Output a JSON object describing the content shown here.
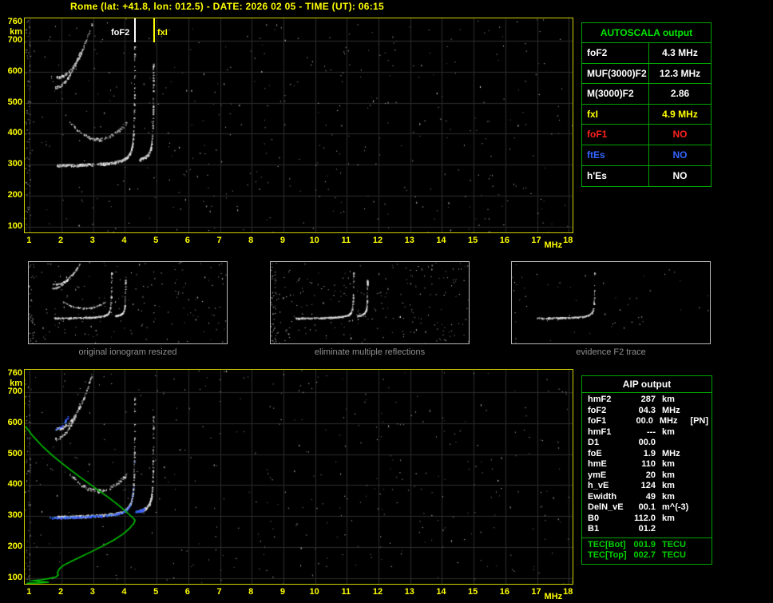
{
  "header": {
    "title": "Rome (lat: +41.8, lon: 012.5) - DATE: 2026 02 05 - TIME (UT): 06:15"
  },
  "autoscala_table": {
    "title": "AUTOSCALA output",
    "rows": [
      {
        "label": "foF2",
        "value": "4.3 MHz",
        "color": "#ffffff"
      },
      {
        "label": "MUF(3000)F2",
        "value": "12.3 MHz",
        "color": "#ffffff"
      },
      {
        "label": "M(3000)F2",
        "value": "2.86",
        "color": "#ffffff"
      },
      {
        "label": "fxI",
        "value": "4.9 MHz",
        "color": "#ffff00"
      },
      {
        "label": "foF1",
        "value": "NO",
        "color": "#ff2020"
      },
      {
        "label": "ftEs",
        "value": "NO",
        "color": "#3366ff"
      },
      {
        "label": "h'Es",
        "value": "NO",
        "color": "#ffffff"
      }
    ]
  },
  "thumbnails": [
    {
      "caption": "original ionogram resized"
    },
    {
      "caption": "eliminate multiple reflections"
    },
    {
      "caption": "evidence F2 trace"
    }
  ],
  "aip_table": {
    "title": "AIP output",
    "rows": [
      {
        "name": "hmF2",
        "value": "287",
        "unit": "km",
        "note": ""
      },
      {
        "name": "foF2",
        "value": "04.3",
        "unit": "MHz",
        "note": ""
      },
      {
        "name": "foF1",
        "value": "00.0",
        "unit": "MHz",
        "note": "[PN]"
      },
      {
        "name": "hmF1",
        "value": "---",
        "unit": "km",
        "note": ""
      },
      {
        "name": "D1",
        "value": "00.0",
        "unit": "",
        "note": ""
      },
      {
        "name": "foE",
        "value": "1.9",
        "unit": "MHz",
        "note": ""
      },
      {
        "name": "hmE",
        "value": "110",
        "unit": "km",
        "note": ""
      },
      {
        "name": "ymE",
        "value": "20",
        "unit": "km",
        "note": ""
      },
      {
        "name": "h_vE",
        "value": "124",
        "unit": "km",
        "note": ""
      },
      {
        "name": "Ewidth",
        "value": "49",
        "unit": "km",
        "note": ""
      },
      {
        "name": "DelN_vE",
        "value": "00.1",
        "unit": "m^(-3)",
        "note": ""
      },
      {
        "name": "B0",
        "value": "112.0",
        "unit": "km",
        "note": ""
      },
      {
        "name": "B1",
        "value": "01.2",
        "unit": "",
        "note": ""
      }
    ],
    "tec_rows": [
      {
        "name": "TEC[Bot]",
        "value": "001.9",
        "unit": "TECU"
      },
      {
        "name": "TEC[Top]",
        "value": "002.7",
        "unit": "TECU"
      }
    ]
  },
  "chart_data": {
    "type": "scatter",
    "description": "Vertical-incidence ionograms (virtual height km vs frequency MHz). Top: recorded ionogram with autoscaled foF2/fxI markers. Bottom: same ionogram with restored trace (blue) and electron density profile (green).",
    "x_axis": {
      "label": "MHz",
      "ticks": [
        1,
        2,
        3,
        4,
        5,
        6,
        7,
        8,
        9,
        10,
        11,
        12,
        13,
        14,
        15,
        16,
        17,
        18
      ],
      "range": [
        0.84,
        18.12
      ]
    },
    "y_axis": {
      "label": "km",
      "ticks": [
        760,
        700,
        600,
        500,
        400,
        300,
        200,
        100
      ],
      "gridlines": [
        100,
        200,
        300,
        400,
        500,
        600,
        700
      ],
      "range": [
        82,
        772
      ]
    },
    "grid_color": "#2d2d2d",
    "border_color": "#d0d000",
    "profile_color": "#00c000",
    "annotations": {
      "foF2_label": "foF2",
      "foF2_mhz": 4.3,
      "fxI_label": "fxI",
      "fxI_mhz": 4.9
    },
    "scaled_values": {
      "foF2_mhz": 4.3,
      "fxI_mhz": 4.9,
      "hmF2_km": 287,
      "MUF3000F2_mhz": 12.3,
      "M3000F2": 2.86
    },
    "traces": {
      "f2_ordinary": {
        "type": "asym",
        "f0": 1.85,
        "f1": 4.295,
        "h0": 292,
        "a": 12,
        "fc": 4.305,
        "p": 0.72,
        "n": 300,
        "jitter": 4,
        "hmax": 740
      },
      "f2_cusp": {
        "type": "asym",
        "f0": 3.3,
        "f1": 4.297,
        "h0": 292,
        "a": 12,
        "fc": 4.305,
        "p": 0.72,
        "n": 130,
        "jitter": 3,
        "bias": 3,
        "hmax": 755
      },
      "fx_cusp": {
        "type": "asym",
        "f0": 4.45,
        "f1": 4.888,
        "h0": 300,
        "a": 10,
        "fc": 4.895,
        "p": 0.7,
        "n": 150,
        "jitter": 4,
        "bias": 2.2,
        "hmax": 755
      },
      "multiple_arc": {
        "type": "parab",
        "f0": 2.25,
        "f1": 4.05,
        "hc": 383,
        "fcen": 3.15,
        "w": 0.9,
        "k": 55,
        "n": 100,
        "jitter": 5
      },
      "second_hop_a": {
        "type": "pow",
        "f0": 1.82,
        "f1": 2.95,
        "h0": 583,
        "amp": 175,
        "p": 2.2,
        "n": 110,
        "jitter": 4,
        "hmax": 760
      },
      "second_hop_b": {
        "type": "pow",
        "f0": 1.78,
        "f1": 2.58,
        "h0": 550,
        "amp": 115,
        "p": 2.0,
        "n": 70,
        "jitter": 4
      },
      "blue_restored": [
        {
          "type": "asym",
          "f0": 1.62,
          "f1": 4.29,
          "h0": 290,
          "a": 12,
          "fc": 4.305,
          "p": 0.72,
          "n": 210,
          "jitter": 2.5,
          "color": "blue"
        },
        {
          "type": "asym",
          "f0": 4.3,
          "f1": 4.6,
          "h0": 300,
          "a": 10,
          "fc": 4.895,
          "p": 0.7,
          "n": 45,
          "jitter": 3,
          "color": "blue",
          "hmax": 460
        },
        {
          "type": "pow",
          "f0": 1.8,
          "f1": 2.2,
          "h0": 583,
          "amp": 40,
          "p": 2.0,
          "n": 30,
          "jitter": 3,
          "color": "blue"
        }
      ]
    },
    "profile_points": [
      [
        0.86,
        590
      ],
      [
        1.1,
        558
      ],
      [
        1.4,
        525
      ],
      [
        1.7,
        497
      ],
      [
        2.0,
        472
      ],
      [
        2.3,
        448
      ],
      [
        2.6,
        425
      ],
      [
        2.9,
        403
      ],
      [
        3.2,
        381
      ],
      [
        3.5,
        359
      ],
      [
        3.8,
        335
      ],
      [
        4.0,
        318
      ],
      [
        4.15,
        304
      ],
      [
        4.27,
        293
      ],
      [
        4.32,
        287
      ],
      [
        4.28,
        277
      ],
      [
        4.15,
        261
      ],
      [
        3.95,
        243
      ],
      [
        3.65,
        223
      ],
      [
        3.3,
        204
      ],
      [
        2.95,
        186
      ],
      [
        2.6,
        169
      ],
      [
        2.3,
        154
      ],
      [
        2.05,
        141
      ],
      [
        1.93,
        130
      ],
      [
        1.9,
        124
      ],
      [
        1.87,
        117
      ],
      [
        1.9,
        111
      ],
      [
        1.82,
        104
      ],
      [
        1.6,
        99
      ],
      [
        1.35,
        95
      ],
      [
        1.1,
        92
      ],
      [
        1.35,
        89
      ],
      [
        1.6,
        87
      ],
      [
        1.25,
        85
      ],
      [
        0.9,
        84
      ]
    ]
  }
}
